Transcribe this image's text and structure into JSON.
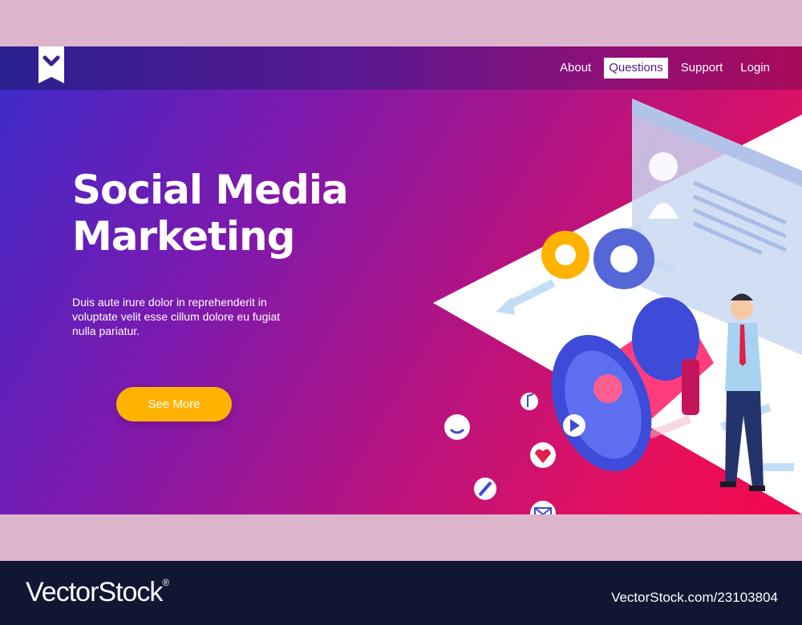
{
  "nav": {
    "logo_icon": "chevron-down-bookmark-icon",
    "links": [
      {
        "label": "About",
        "active": false
      },
      {
        "label": "Questions",
        "active": true
      },
      {
        "label": "Support",
        "active": false
      },
      {
        "label": "Login",
        "active": false
      }
    ]
  },
  "hero": {
    "title_line1": "Social Media",
    "title_line2": "Marketing",
    "description": "Duis aute irure dolor in reprehenderit in voluptate velit esse  cillum dolore eu fugiat nulla pariatur.",
    "cta_label": "See More"
  },
  "illustration": {
    "icons": [
      "megaphone-icon",
      "gear-icon",
      "profile-window-icon",
      "smiley-icon",
      "music-note-icon",
      "play-icon",
      "heart-icon",
      "pencil-icon",
      "mail-icon",
      "businessman-icon"
    ]
  },
  "footer": {
    "brand": "VectorStock",
    "brand_mark": "®",
    "stock_id": "VectorStock.com/23103804"
  },
  "colors": {
    "accent": "#ffb300",
    "gradient_start": "#3a2bc9",
    "gradient_end": "#f2074f",
    "frame": "#dcb4cc",
    "footer_bg": "#0f1733"
  }
}
